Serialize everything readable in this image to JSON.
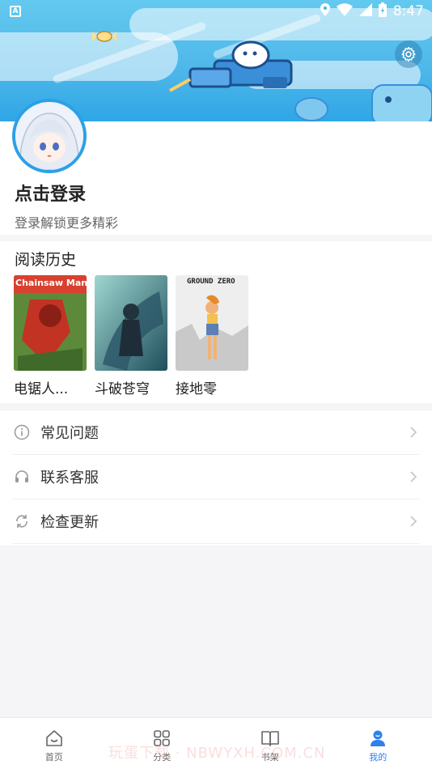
{
  "status_bar": {
    "left_badge": "A",
    "time": "8:47"
  },
  "profile": {
    "login_title": "点击登录",
    "login_subtitle": "登录解锁更多精彩"
  },
  "history": {
    "title": "阅读历史",
    "books": [
      {
        "title": "电锯人...",
        "cover_text": "Chainsaw Man",
        "cover_color": "#d8412f"
      },
      {
        "title": "斗破苍穹",
        "cover_text": "",
        "cover_color": "#2f6f7a"
      },
      {
        "title": "接地零",
        "cover_text": "GROUND ZERO",
        "cover_color": "#e8e8e8"
      }
    ]
  },
  "menu": [
    {
      "label": "常见问题",
      "icon": "info-icon"
    },
    {
      "label": "联系客服",
      "icon": "headset-icon"
    },
    {
      "label": "检查更新",
      "icon": "refresh-icon"
    }
  ],
  "bottom_nav": [
    {
      "label": "首页",
      "icon": "home-icon",
      "active": false
    },
    {
      "label": "分类",
      "icon": "grid-icon",
      "active": false
    },
    {
      "label": "书架",
      "icon": "book-icon",
      "active": false
    },
    {
      "label": "我的",
      "icon": "user-icon",
      "active": true
    }
  ],
  "watermark": "玩蛋下载 · NBWYXH.COM.CN",
  "colors": {
    "accent": "#2f80ed",
    "banner": "#4fb8ea"
  }
}
